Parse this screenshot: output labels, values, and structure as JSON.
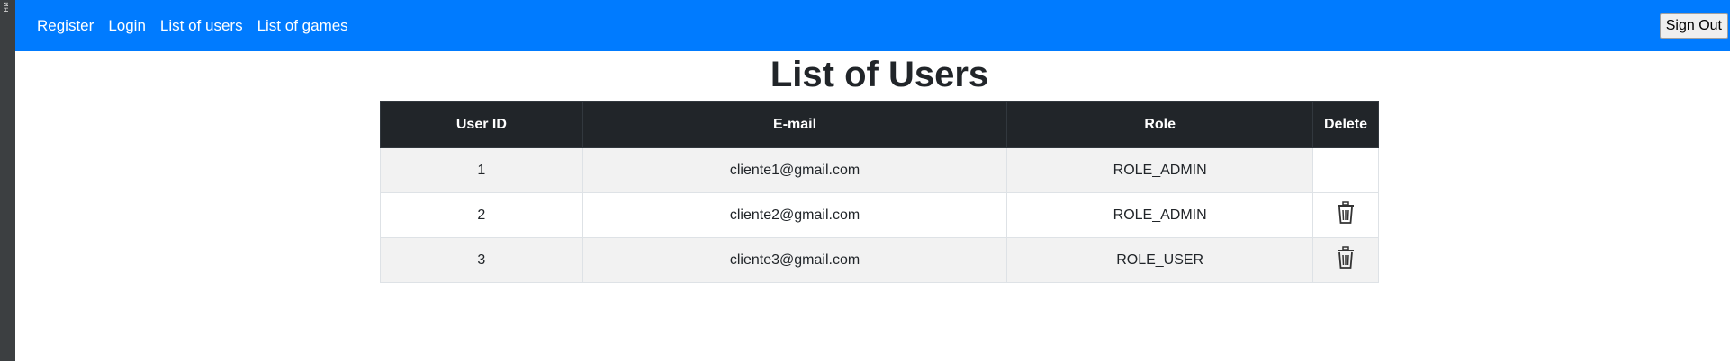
{
  "nav": {
    "links": [
      {
        "label": "Register"
      },
      {
        "label": "Login"
      },
      {
        "label": "List of users"
      },
      {
        "label": "List of games"
      }
    ],
    "signout_label": "Sign Out"
  },
  "page": {
    "title": "List of Users"
  },
  "table": {
    "headers": [
      "User ID",
      "E-mail",
      "Role",
      "Delete"
    ],
    "rows": [
      {
        "id": "1",
        "email": "cliente1@gmail.com",
        "role": "ROLE_ADMIN",
        "delete_icon": ""
      },
      {
        "id": "2",
        "email": "cliente2@gmail.com",
        "role": "ROLE_ADMIN",
        "delete_icon": "trash-icon"
      },
      {
        "id": "3",
        "email": "cliente3@gmail.com",
        "role": "ROLE_USER",
        "delete_icon": "trash-icon"
      }
    ]
  },
  "colors": {
    "navbar": "#007bff",
    "table_header": "#212529",
    "stripe": "#f2f2f2"
  }
}
